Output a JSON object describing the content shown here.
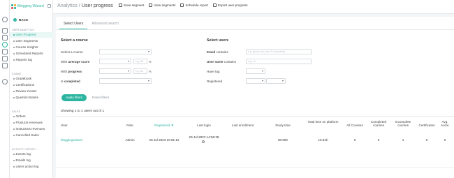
{
  "app": {
    "name": "Blogging Wizard"
  },
  "page": {
    "breadcrumb": "Analytics / ",
    "title": "User progress"
  },
  "toolbar": [
    {
      "label": "Save segment",
      "icon": "save-icon"
    },
    {
      "label": "View segments",
      "icon": "segments-icon"
    },
    {
      "label": "Schedule report",
      "icon": "calendar-icon"
    },
    {
      "label": "Export user progress",
      "icon": "export-icon"
    }
  ],
  "sidebar": {
    "back_label": "BACK",
    "sections": {
      "user_analytics": "USER ANALYTICS",
      "exams": "EXAMS",
      "sales": "SALES",
      "activity": "ACTIVITY HISTORY"
    },
    "items": [
      "User Progress",
      "User Segments",
      "Course Insights",
      "Scheduled Reports",
      "Reports log",
      "Gradebook",
      "Certifications",
      "Review Center",
      "Question Banks",
      "Orders",
      "Products revenues",
      "Instructors revenues",
      "Cancelled Sales",
      "Events log",
      "Emails log",
      "Users action log"
    ]
  },
  "tabs": [
    "Select Users",
    "Advanced search"
  ],
  "filters": {
    "course": {
      "title": "Select a course",
      "select_course": "Select a course",
      "with_average_score": {
        "pre": "With ",
        "bold": "average score"
      },
      "with_progress": {
        "pre": "With ",
        "bold": "progress"
      },
      "is_completed": {
        "pre": "Is ",
        "bold": "completed"
      },
      "score_placeholder": "e.g. 80",
      "progress_placeholder": "e.g. 80",
      "pct": "%"
    },
    "users": {
      "title": "Select users",
      "email": {
        "bold": "Email",
        "post": " contains"
      },
      "username": {
        "bold": "User name",
        "post": " contains"
      },
      "have_tag": "Have tag",
      "registered": "Registered",
      "email_placeholder": "e.g. gmail.com (min 3 characters)",
      "username_placeholder": "e.g. Jo"
    },
    "apply_label": "Apply filters",
    "reset_label": "Reset filters"
  },
  "results": {
    "showing": "Showing 1 to 1 users out of 1",
    "columns": {
      "user": "User",
      "role": "Role",
      "registered": "Registered ▼",
      "last_login": "Last login",
      "last_enrollment": "Last enrollment",
      "study_time": "Study time",
      "total_time": "Total time on platform",
      "all_courses": "All Courses",
      "completed_courses": "Completed courses",
      "incomplete_courses": "Incomplete courses",
      "certificates": "Certificates",
      "avg_score": "Avg. score"
    },
    "rows": [
      {
        "user": "bloggingwizard",
        "role": "Admin",
        "registered": "28 Jul 2023 10:51:12",
        "last_login": "29 Jul 2023 14:56:38",
        "last_enrollment": "",
        "study_time": "00:05h",
        "total_time": "10:31h",
        "all_courses": "0",
        "completed_courses": "0",
        "incomplete_courses": "1",
        "certificates": "0",
        "avg_score": "0"
      }
    ]
  },
  "colors": {
    "accent": "#2bb5a0",
    "background": "#f4f5f7"
  }
}
